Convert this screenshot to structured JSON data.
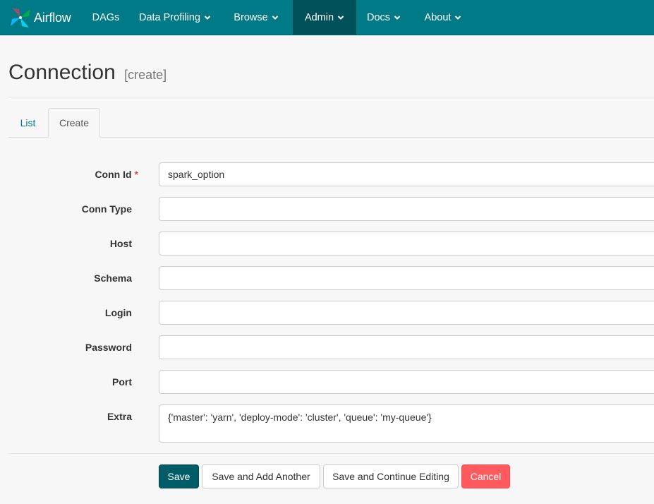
{
  "navbar": {
    "brand": "Airflow",
    "items": [
      {
        "label": "DAGs",
        "dropdown": false,
        "active": false
      },
      {
        "label": "Data Profiling",
        "dropdown": true,
        "active": false
      },
      {
        "label": "Browse",
        "dropdown": true,
        "active": false
      },
      {
        "label": "Admin",
        "dropdown": true,
        "active": true
      },
      {
        "label": "Docs",
        "dropdown": true,
        "active": false
      },
      {
        "label": "About",
        "dropdown": true,
        "active": false
      }
    ],
    "color": "#007a87",
    "active_color": "#00515a"
  },
  "page": {
    "title": "Connection",
    "subtitle": "[create]"
  },
  "tabs": [
    {
      "label": "List",
      "active": false
    },
    {
      "label": "Create",
      "active": true
    }
  ],
  "form": {
    "required_marker": "*",
    "fields": [
      {
        "label": "Conn Id",
        "value": "spark_option",
        "required": true
      },
      {
        "label": "Conn Type",
        "value": ""
      },
      {
        "label": "Host",
        "value": ""
      },
      {
        "label": "Schema",
        "value": ""
      },
      {
        "label": "Login",
        "value": ""
      },
      {
        "label": "Password",
        "value": ""
      },
      {
        "label": "Port",
        "value": ""
      },
      {
        "label": "Extra",
        "value": "{'master': 'yarn', 'deploy-mode': 'cluster', 'queue': 'my-queue'}"
      }
    ]
  },
  "buttons": {
    "save": "Save",
    "save_add": "Save and Add Another",
    "save_continue": "Save and Continue Editing",
    "cancel": "Cancel"
  },
  "colors": {
    "primary": "#005c66",
    "danger": "#ff5a5f",
    "link": "#007a87",
    "required": "#d9534f"
  }
}
